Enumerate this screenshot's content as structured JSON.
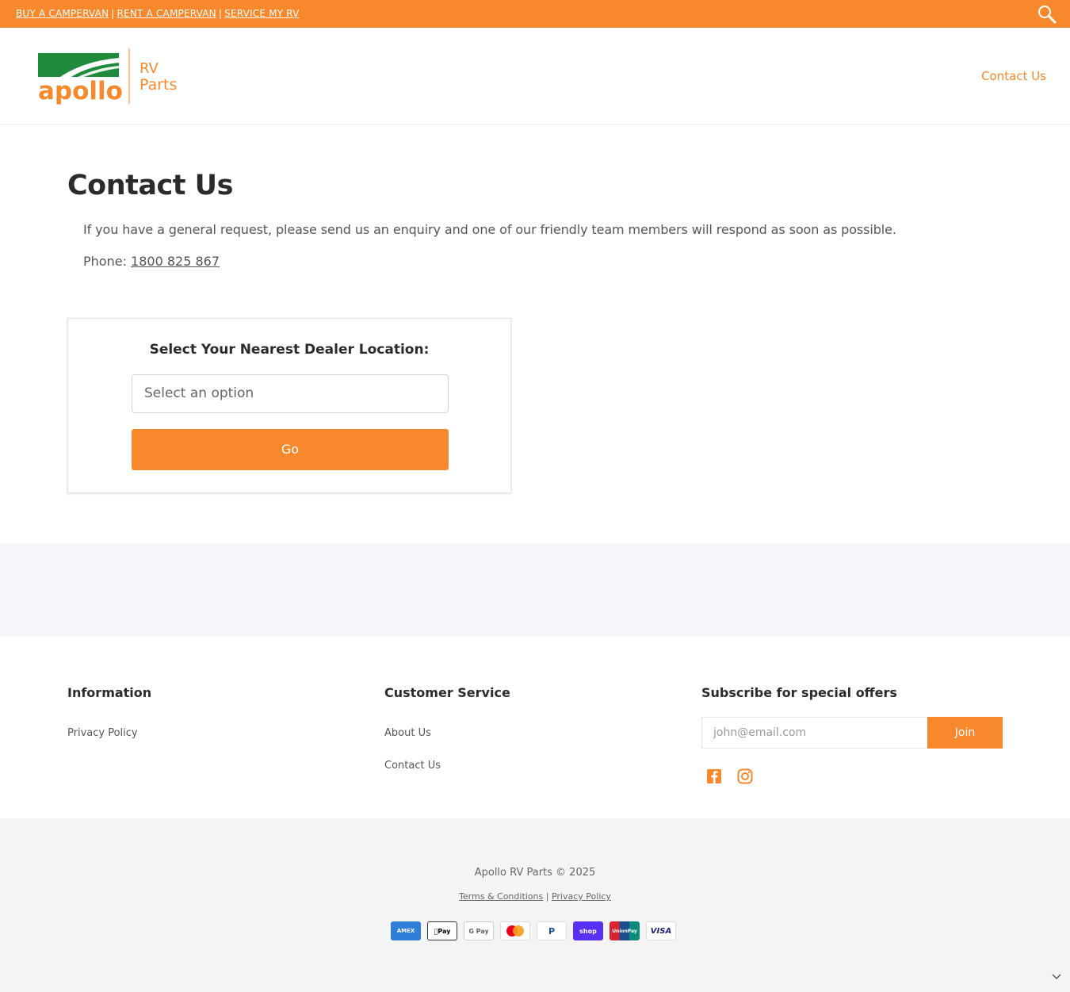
{
  "topbar": {
    "links": [
      "BUY A CAMPERVAN",
      "RENT A CAMPERVAN",
      "SERVICE MY RV"
    ],
    "separator": "|",
    "search_icon": "search-icon"
  },
  "header": {
    "logo_brand": "apollo",
    "logo_sub_top": "RV",
    "logo_sub_bottom": "Parts",
    "nav_contact": "Contact Us"
  },
  "main": {
    "title": "Contact Us",
    "intro": "If you have a general request, please send us an enquiry and one of our friendly team members will respond as soon as possible.",
    "phone_label": "Phone:",
    "phone_number": "1800 825 867",
    "dealer": {
      "heading": "Select Your Nearest Dealer Location:",
      "select_value": "Select an option",
      "go_label": "Go"
    }
  },
  "footer": {
    "information": {
      "heading": "Information",
      "links": [
        "Privacy Policy"
      ]
    },
    "customer_service": {
      "heading": "Customer Service",
      "links": [
        "About Us",
        "Contact Us"
      ]
    },
    "subscribe": {
      "heading": "Subscribe for special offers",
      "email_placeholder": "john@email.com",
      "join_label": "Join",
      "social_icons": [
        "facebook-icon",
        "instagram-icon"
      ]
    }
  },
  "bottom": {
    "copyright": "Apollo RV Parts © 2025",
    "legal_links": [
      "Terms & Conditions",
      "Privacy Policy"
    ],
    "legal_separator": "|",
    "payments": [
      {
        "name": "american-express",
        "label": "AMEX"
      },
      {
        "name": "apple-pay",
        "label": "Pay"
      },
      {
        "name": "google-pay",
        "label": "G Pay"
      },
      {
        "name": "mastercard",
        "label": ""
      },
      {
        "name": "paypal",
        "label": "P"
      },
      {
        "name": "shop-pay",
        "label": "shop"
      },
      {
        "name": "union-pay",
        "label": "UnionPay"
      },
      {
        "name": "visa",
        "label": "VISA"
      }
    ]
  },
  "colors": {
    "accent": "#f7892c",
    "brand_green": "#1f8a3b",
    "title_text": "#2b2b2b",
    "band": "#f5f6fb"
  }
}
